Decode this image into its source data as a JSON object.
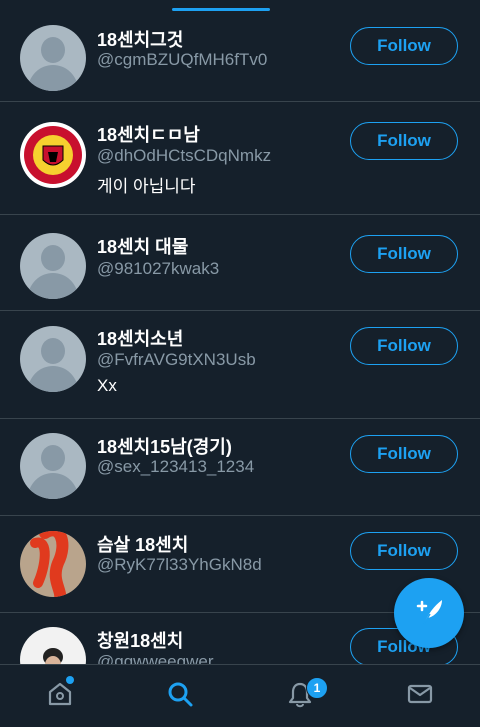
{
  "users": [
    {
      "name": "18센치그것",
      "handle": "@cgmBZUQfMH6fTv0",
      "bio": "",
      "follow_label": "Follow",
      "avatar": "default"
    },
    {
      "name": "18센치ㄷㅁ남",
      "handle": "@dhOdHCtsCDqNmkz",
      "bio": "게이 아닙니다",
      "follow_label": "Follow",
      "avatar": "crest"
    },
    {
      "name": "18센치 대물",
      "handle": "@981027kwak3",
      "bio": "",
      "follow_label": "Follow",
      "avatar": "default"
    },
    {
      "name": "18센치소년",
      "handle": "@FvfrAVG9tXN3Usb",
      "bio": "Xx",
      "follow_label": "Follow",
      "avatar": "default"
    },
    {
      "name": "18센치15남(경기)",
      "handle": "@sex_123413_1234",
      "bio": "",
      "follow_label": "Follow",
      "avatar": "default"
    },
    {
      "name": "슴살 18센치",
      "handle": "@RyK77l33YhGkN8d",
      "bio": "",
      "follow_label": "Follow",
      "avatar": "redacted"
    },
    {
      "name": "창원18센치",
      "handle": "@gqwweegwer",
      "bio": "",
      "follow_label": "Follow",
      "avatar": "photo"
    }
  ],
  "nav": {
    "items": [
      {
        "name": "home-icon"
      },
      {
        "name": "search-icon"
      },
      {
        "name": "bell-icon"
      },
      {
        "name": "mail-icon"
      }
    ],
    "notifications_badge": "1"
  },
  "fab": {
    "icon": "compose-icon"
  },
  "colors": {
    "background": "#15202b",
    "accent": "#1da1f2",
    "divider": "#38444d",
    "muted": "#8899a6"
  }
}
